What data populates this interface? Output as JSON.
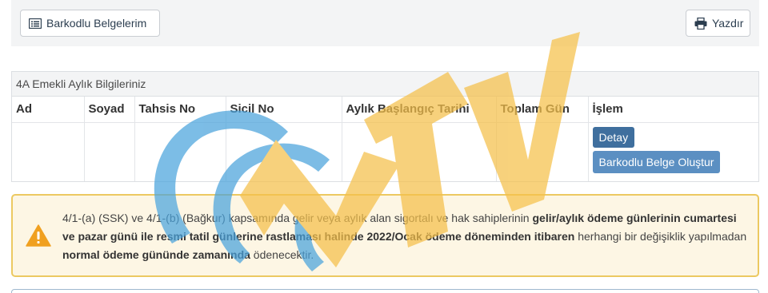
{
  "toolbar": {
    "barkodlu_label": "Barkodlu Belgelerim",
    "yazdir_label": "Yazdır"
  },
  "panel": {
    "heading": "4A Emekli Aylık Bilgileriniz",
    "columns": [
      "Ad",
      "Soyad",
      "Tahsis No",
      "Sicil No",
      "Aylık Başlangıç Tarihi",
      "Toplam Gün",
      "İşlem"
    ],
    "row": {
      "detay_label": "Detay",
      "barkodlu_olustur_label": "Barkodlu Belge Oluştur"
    }
  },
  "alert": {
    "t1": "4/1-(a) (SSK) ve 4/1-(b) (Bağkur) kapsamında gelir veya aylık alan sigortalı ve hak sahiplerinin ",
    "b1": "gelir/aylık ödeme günlerinin cumartesi ve pazar günü ile resmi tatil günlerine rastlaması halinde 2022/Ocak ödeme döneminden itibaren",
    "t2": " herhangi bir değişiklik yapılmadan ",
    "b2": "normal ödeme gününde zamanında",
    "t3": " ödenecektir."
  },
  "colors": {
    "primary": "#3f6f9e",
    "secondary": "#5b8fc2",
    "warning_bg": "#fdf6e4",
    "warning_border": "#ecc961",
    "watermark_blue": "#4aa3dc",
    "watermark_orange": "#f5c04a"
  },
  "icons": {
    "barkodlu": "list-alt-icon",
    "yazdir": "printer-icon",
    "alert": "warning-triangle-icon"
  }
}
